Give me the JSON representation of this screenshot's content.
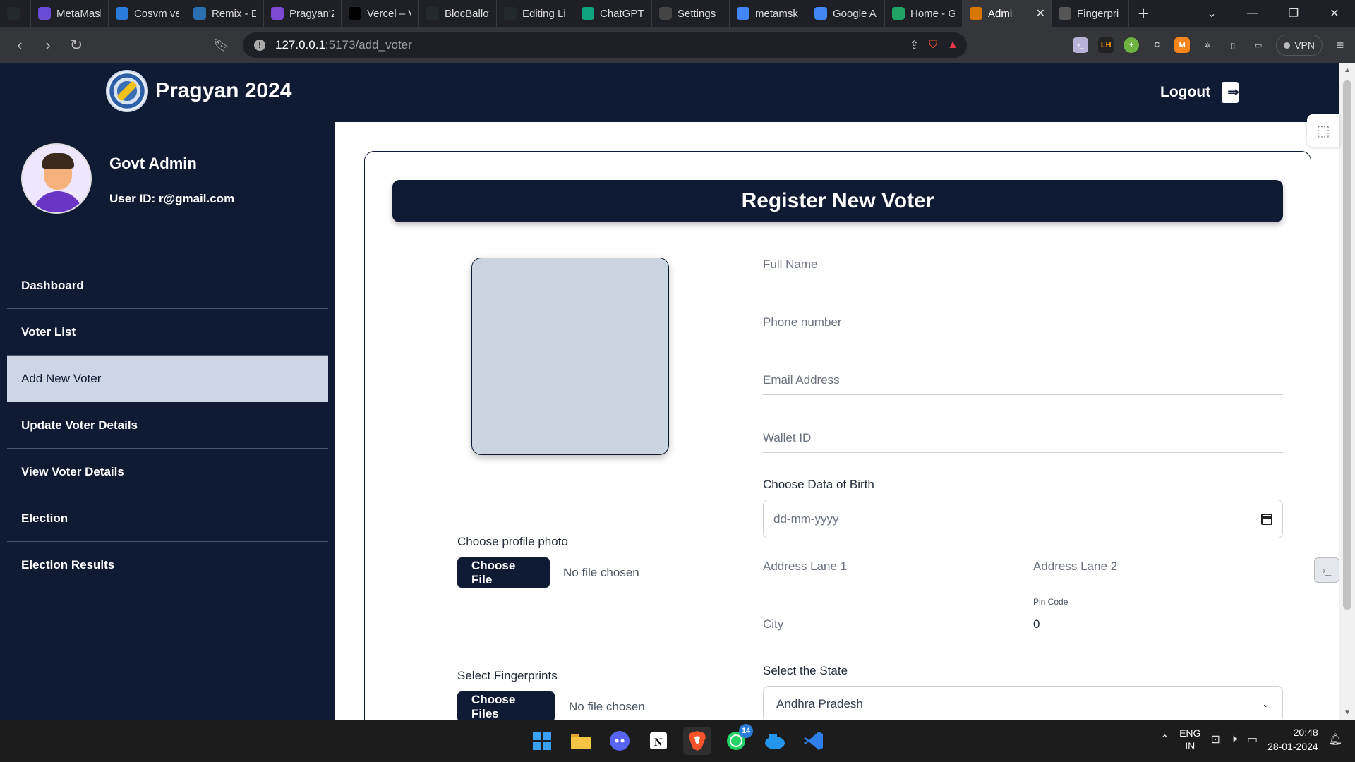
{
  "browser": {
    "tabs": [
      {
        "label": "",
        "icon": "github-icon",
        "color": "#24292e"
      },
      {
        "label": "MetaMask",
        "icon": "metamask-icon",
        "color": "#6a4bd6"
      },
      {
        "label": "Cosvm ve",
        "icon": "cosvm-icon",
        "color": "#2b7bd8"
      },
      {
        "label": "Remix - E",
        "icon": "remix-icon",
        "color": "#2a6fb0"
      },
      {
        "label": "Pragyan'2",
        "icon": "pragyan-icon",
        "color": "#7b4ad0"
      },
      {
        "label": "Vercel – V",
        "icon": "vercel-icon",
        "color": "#000000"
      },
      {
        "label": "BlocBallot",
        "icon": "github-icon",
        "color": "#24292e"
      },
      {
        "label": "Editing Li",
        "icon": "github-icon",
        "color": "#24292e"
      },
      {
        "label": "ChatGPT",
        "icon": "chatgpt-icon",
        "color": "#10a37f"
      },
      {
        "label": "Settings",
        "icon": "gear-icon",
        "color": "#444444"
      },
      {
        "label": "metamsk",
        "icon": "google-icon",
        "color": "#4285f4"
      },
      {
        "label": "Google A",
        "icon": "google-icon",
        "color": "#4285f4"
      },
      {
        "label": "Home - G",
        "icon": "drive-icon",
        "color": "#1fa463"
      },
      {
        "label": "Admi",
        "icon": "admin-icon",
        "color": "#d97706",
        "active": true
      },
      {
        "label": "Fingerpri",
        "icon": "globe-icon",
        "color": "#555555"
      }
    ],
    "url_host": "127.0.0.1",
    "url_path": ":5173/add_voter",
    "vpn_label": "VPN"
  },
  "header": {
    "title": "Pragyan 2024",
    "logout_label": "Logout"
  },
  "sidebar": {
    "admin_name": "Govt Admin",
    "user_id": "User ID: r@gmail.com",
    "items": [
      {
        "label": "Dashboard",
        "active": false
      },
      {
        "label": "Voter List",
        "active": false
      },
      {
        "label": "Add New Voter",
        "active": true
      },
      {
        "label": "Update Voter Details",
        "active": false
      },
      {
        "label": "View Voter Details",
        "active": false
      },
      {
        "label": "Election",
        "active": false
      },
      {
        "label": "Election Results",
        "active": false
      }
    ]
  },
  "form": {
    "title": "Register New Voter",
    "photo_label": "Choose profile photo",
    "photo_button": "Choose File",
    "photo_status": "No file chosen",
    "fingerprint_label": "Select Fingerprints",
    "fingerprint_button": "Choose Files",
    "fingerprint_status": "No file chosen",
    "full_name_placeholder": "Full Name",
    "phone_placeholder": "Phone number",
    "email_placeholder": "Email Address",
    "wallet_placeholder": "Wallet ID",
    "dob_label": "Choose Data of Birth",
    "dob_placeholder": "dd-mm-yyyy",
    "address1_placeholder": "Address Lane 1",
    "address2_placeholder": "Address Lane 2",
    "city_placeholder": "City",
    "pincode_label": "Pin Code",
    "pincode_value": "0",
    "state_label": "Select the State",
    "state_value": "Andhra Pradesh"
  },
  "taskbar": {
    "apps": [
      "windows-start",
      "file-explorer",
      "discord",
      "notion",
      "brave",
      "whatsapp",
      "docker",
      "vscode"
    ],
    "whatsapp_badge": "14",
    "lang_line1": "ENG",
    "lang_line2": "IN",
    "time": "20:48",
    "date": "28-01-2024"
  },
  "colors": {
    "navy": "#0f1a33",
    "active_menu": "#cdd6e4",
    "photo_placeholder": "#cbd5e1"
  }
}
